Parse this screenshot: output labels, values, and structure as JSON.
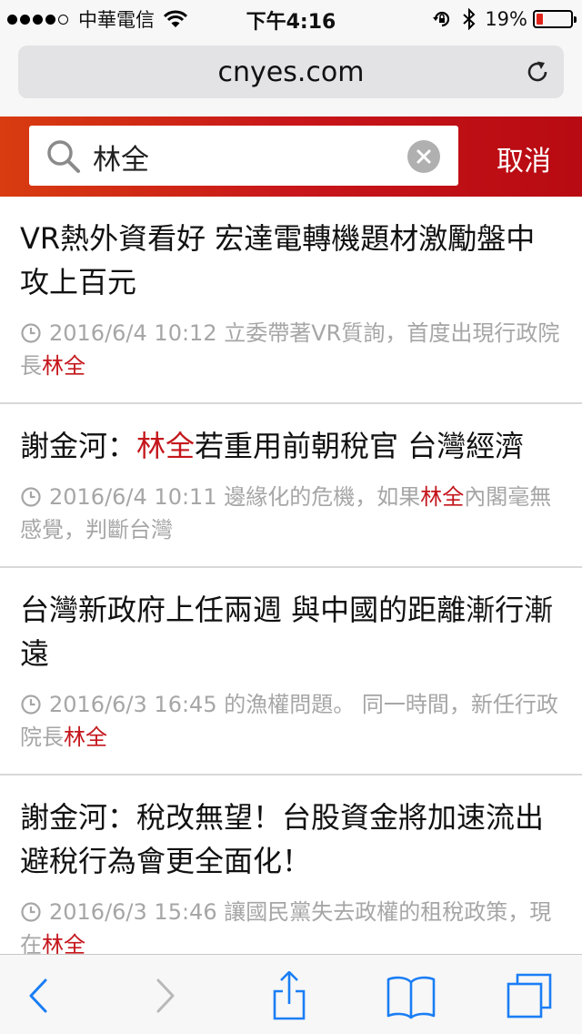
{
  "status_bar": {
    "carrier": "中華電信",
    "time": "下午4:16",
    "battery_percent": "19%",
    "battery_level": 0.19,
    "signal_dots_filled": 4,
    "signal_dots_total": 5,
    "battery_color": "#e0241b"
  },
  "browser": {
    "url": "cnyes.com",
    "reload_icon": "reload-icon"
  },
  "search": {
    "query": "林全",
    "cancel_label": "取消",
    "search_icon": "search-icon",
    "clear_icon": "clear-icon",
    "header_color": "#c8161a"
  },
  "articles": [
    {
      "headline": "VR熱外資看好 宏達電轉機題材激勵盤中攻上百元",
      "timestamp": "2016/6/4 10:12",
      "snippet_before": "立委帶著VR質詢，首度出現行政院長",
      "snippet_highlight": "林全",
      "snippet_after": ""
    },
    {
      "headline_before": "謝金河：",
      "headline_highlight": "林全",
      "headline_after": "若重用前朝稅官 台灣經濟",
      "timestamp": "2016/6/4 10:11",
      "snippet_before": "邊緣化的危機，如果",
      "snippet_highlight": "林全",
      "snippet_after": "內閣毫無感覺，判斷台灣"
    },
    {
      "headline": "台灣新政府上任兩週 與中國的距離漸行漸遠",
      "timestamp": "2016/6/3 16:45",
      "snippet_before": "的漁權問題。 同一時間，新任行政院長",
      "snippet_highlight": "林全",
      "snippet_after": ""
    },
    {
      "headline": "謝金河：稅改無望！台股資金將加速流出 避稅行為會更全面化！",
      "timestamp": "2016/6/3 15:46",
      "snippet_before": "讓國民黨失去政權的租稅政策，現在",
      "snippet_highlight": "林全",
      "snippet_after": ""
    }
  ],
  "highlight_color": "#c4161c",
  "toolbar": {
    "back_icon": "back-icon",
    "forward_icon": "forward-icon",
    "share_icon": "share-icon",
    "bookmarks_icon": "bookmarks-icon",
    "tabs_icon": "tabs-icon",
    "tint_color": "#1a7ef5"
  }
}
